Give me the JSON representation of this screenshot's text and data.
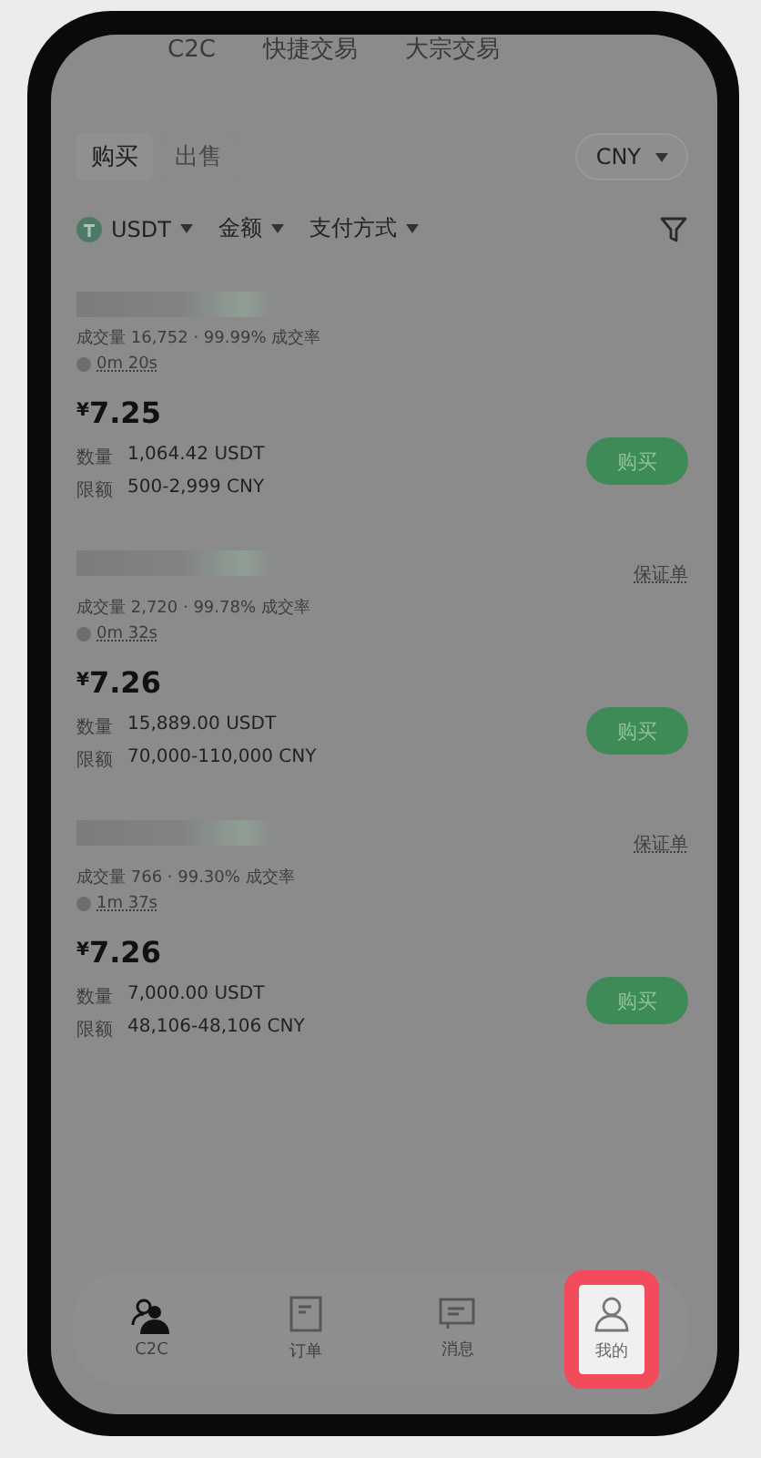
{
  "header_tabs": [
    {
      "label": "C2C"
    },
    {
      "label": "快捷交易"
    },
    {
      "label": "大宗交易"
    }
  ],
  "side_tabs": [
    {
      "label": "购买",
      "selected": true
    },
    {
      "label": "出售",
      "selected": false
    }
  ],
  "currency": "CNY",
  "filters": [
    {
      "kind": "coin",
      "label": "USDT"
    },
    {
      "kind": "menu",
      "label": "金额"
    },
    {
      "kind": "menu",
      "label": "支付方式"
    }
  ],
  "offers": [
    {
      "stats": "成交量 16,752 · 99.99% 成交率",
      "time": "0m 20s",
      "currency_sign": "¥",
      "price": "7.25",
      "quantity_label": "数量",
      "quantity": "1,064.42 USDT",
      "limit_label": "限额",
      "limit": "500-2,999 CNY",
      "button": "购买"
    },
    {
      "stats": "成交量 2,720 · 99.78% 成交率",
      "time": "0m 32s",
      "tag": "保证单",
      "currency_sign": "¥",
      "price": "7.26",
      "quantity_label": "数量",
      "quantity": "15,889.00 USDT",
      "limit_label": "限额",
      "limit": "70,000-110,000 CNY",
      "button": "购买"
    },
    {
      "stats": "成交量 766 · 99.30% 成交率",
      "time": "1m 37s",
      "tag": "保证单",
      "currency_sign": "¥",
      "price": "7.26",
      "quantity_label": "数量",
      "quantity": "7,000.00 USDT",
      "limit_label": "限额",
      "limit": "48,106-48,106 CNY",
      "button": "购买"
    }
  ],
  "bottom_nav": [
    {
      "kind": "people",
      "label": "C2C",
      "selected": false
    },
    {
      "kind": "order",
      "label": "订单",
      "selected": false
    },
    {
      "kind": "message",
      "label": "消息",
      "selected": false
    },
    {
      "kind": "user",
      "label": "我的",
      "selected": true
    }
  ]
}
